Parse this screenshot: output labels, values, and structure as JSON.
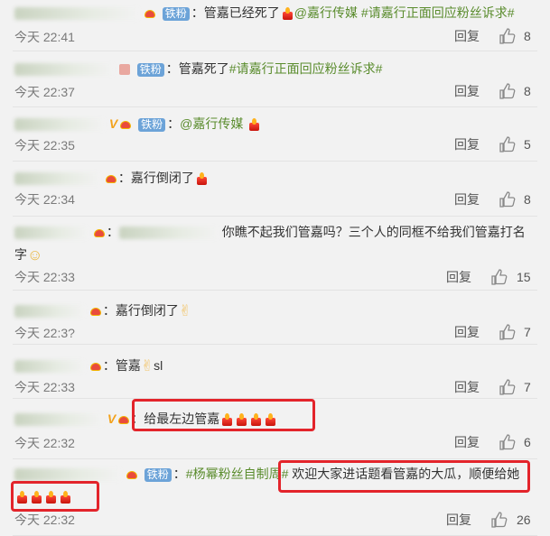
{
  "comments": [
    {
      "text_parts": [
        "管嘉已经死了",
        "@嘉行传媒",
        "#请嘉行正面回应粉丝诉求#"
      ],
      "fan_badge": "铁粉",
      "time": "今天 22:41",
      "reply": "回复",
      "likes": "8"
    },
    {
      "text_parts": [
        "管嘉死了",
        "#请嘉行正面回应粉丝诉求#"
      ],
      "fan_badge": "铁粉",
      "time": "今天 22:37",
      "reply": "回复",
      "likes": "8"
    },
    {
      "text_parts": [
        "@嘉行传媒"
      ],
      "fan_badge": "铁粉",
      "time": "今天 22:35",
      "reply": "回复",
      "likes": "5"
    },
    {
      "text_parts": [
        "嘉行倒闭了"
      ],
      "time": "今天 22:34",
      "reply": "回复",
      "likes": "8"
    },
    {
      "text_parts": [
        "你瞧不起我们管嘉吗？三个人的同框不给我们管嘉打名",
        "字"
      ],
      "time": "今天 22:33",
      "reply": "回复",
      "likes": "15"
    },
    {
      "text_parts": [
        "嘉行倒闭了"
      ],
      "time": "今天 22:3?",
      "reply": "回复",
      "likes": "7"
    },
    {
      "text_parts": [
        "管嘉",
        "sl"
      ],
      "time": "今天 22:33",
      "reply": "回复",
      "likes": "7"
    },
    {
      "text_parts": [
        "给最左边管嘉"
      ],
      "time": "今天 22:32",
      "reply": "回复",
      "likes": "6"
    },
    {
      "text_parts": [
        "#杨幂粉丝自制周#",
        " 欢迎大家进话题看管嘉的大瓜，顺便给她"
      ],
      "fan_badge": "铁粉",
      "time": "今天 22:32",
      "reply": "回复",
      "likes": "26"
    }
  ],
  "icons": {
    "like": "thumbs-up-icon",
    "candle": "candle-emoji-icon",
    "ok_hand": "ok-hand-emoji-icon",
    "face": "thinking-face-emoji-icon"
  },
  "colors": {
    "background": "#f2f2f2",
    "fan_badge": "#6ca3d8",
    "topic_link": "#5a8c2d",
    "highlight_box": "#e3242b"
  }
}
